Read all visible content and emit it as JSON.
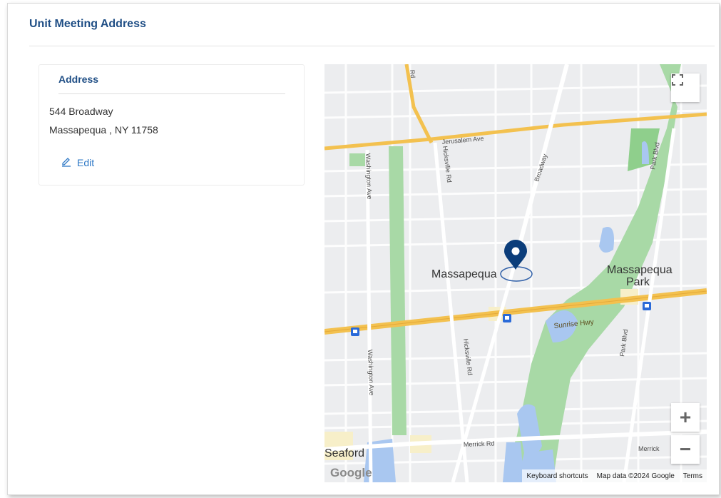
{
  "panel": {
    "title": "Unit Meeting Address"
  },
  "address_card": {
    "title": "Address",
    "line1": "544 Broadway",
    "line2": "Massapequa , NY 11758",
    "edit_label": "Edit"
  },
  "map": {
    "labels": {
      "massapequa": "Massapequa",
      "massapequa_park_1": "Massapequa",
      "massapequa_park_2": "Park",
      "seaford": "Seaford",
      "jerusalem_ave": "Jerusalem Ave",
      "washington_ave_1": "Washington Ave",
      "washington_ave_2": "Washington Ave",
      "hicksville_rd_1": "Hicksville Rd",
      "hicksville_rd_2": "Hicksville Rd",
      "broadway": "Broadway",
      "park_blvd_1": "Park Blvd",
      "park_blvd_2": "Park Blvd",
      "sunrise_hwy": "Sunrise Hwy",
      "merrick_rd_1": "Merrick Rd",
      "merrick_rd_2": "Merrick",
      "rd_top": "Rd",
      "google": "Google"
    },
    "zoom_in": "+",
    "zoom_out": "−",
    "footer": {
      "shortcuts": "Keyboard shortcuts",
      "data": "Map data ©2024 Google",
      "terms": "Terms"
    },
    "colors": {
      "park": "#a8d9a6",
      "water": "#a9c7f0",
      "highway": "#f3c14f",
      "pin": "#0b3d7a"
    }
  }
}
